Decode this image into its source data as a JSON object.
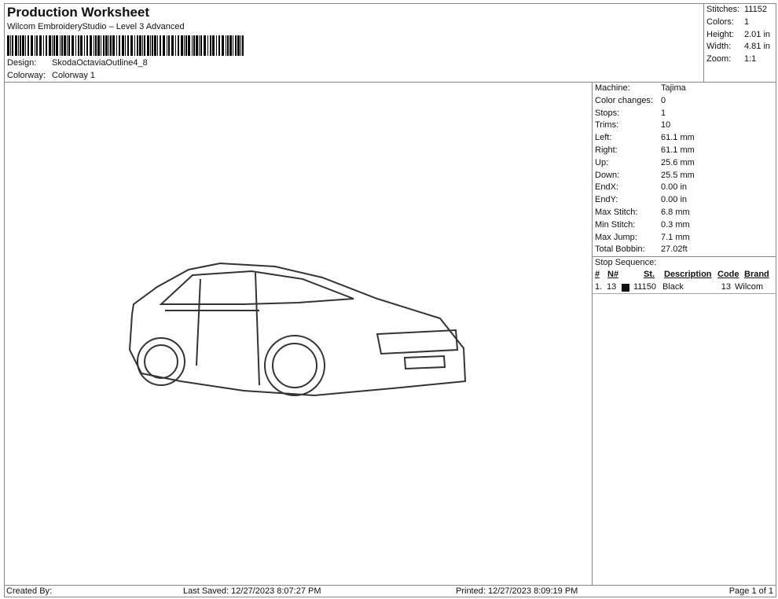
{
  "header": {
    "title": "Production Worksheet",
    "subtitle": "Wilcom EmbroideryStudio – Level 3 Advanced",
    "design_label": "Design:",
    "design": "SkodaOctaviaOutline4_8",
    "colorway_label": "Colorway:",
    "colorway": "Colorway 1"
  },
  "stats": [
    {
      "k": "Stitches:",
      "v": "11152"
    },
    {
      "k": "Colors:",
      "v": "1"
    },
    {
      "k": "Height:",
      "v": "2.01 in"
    },
    {
      "k": "Width:",
      "v": "4.81 in"
    },
    {
      "k": "Zoom:",
      "v": "1:1"
    }
  ],
  "details": [
    {
      "k": "Machine:",
      "v": "Tajima"
    },
    {
      "k": "Color changes:",
      "v": "0"
    },
    {
      "k": "Stops:",
      "v": "1"
    },
    {
      "k": "Trims:",
      "v": "10"
    },
    {
      "k": "Left:",
      "v": "61.1 mm"
    },
    {
      "k": "Right:",
      "v": "61.1 mm"
    },
    {
      "k": "Up:",
      "v": "25.6 mm"
    },
    {
      "k": "Down:",
      "v": "25.5 mm"
    },
    {
      "k": "EndX:",
      "v": "0.00 in"
    },
    {
      "k": "EndY:",
      "v": "0.00 in"
    },
    {
      "k": "Max Stitch:",
      "v": "6.8 mm"
    },
    {
      "k": "Min Stitch:",
      "v": "0.3 mm"
    },
    {
      "k": "Max Jump:",
      "v": "7.1 mm"
    },
    {
      "k": "Total Bobbin:",
      "v": "27.02ft"
    }
  ],
  "stop_sequence": {
    "title": "Stop Sequence:",
    "headers": [
      "#",
      "N#",
      "St.",
      "Description",
      "Code",
      "Brand"
    ],
    "rows": [
      {
        "num": "1.",
        "n": "13",
        "swatch": "#111111",
        "st": "11150",
        "desc": "Black",
        "code": "13",
        "brand": "Wilcom"
      }
    ]
  },
  "footer": {
    "created": "Created By:",
    "saved": "Last Saved: 12/27/2023 8:07:27 PM",
    "printed": "Printed: 12/27/2023 8:09:19 PM",
    "page": "Page 1 of 1"
  }
}
